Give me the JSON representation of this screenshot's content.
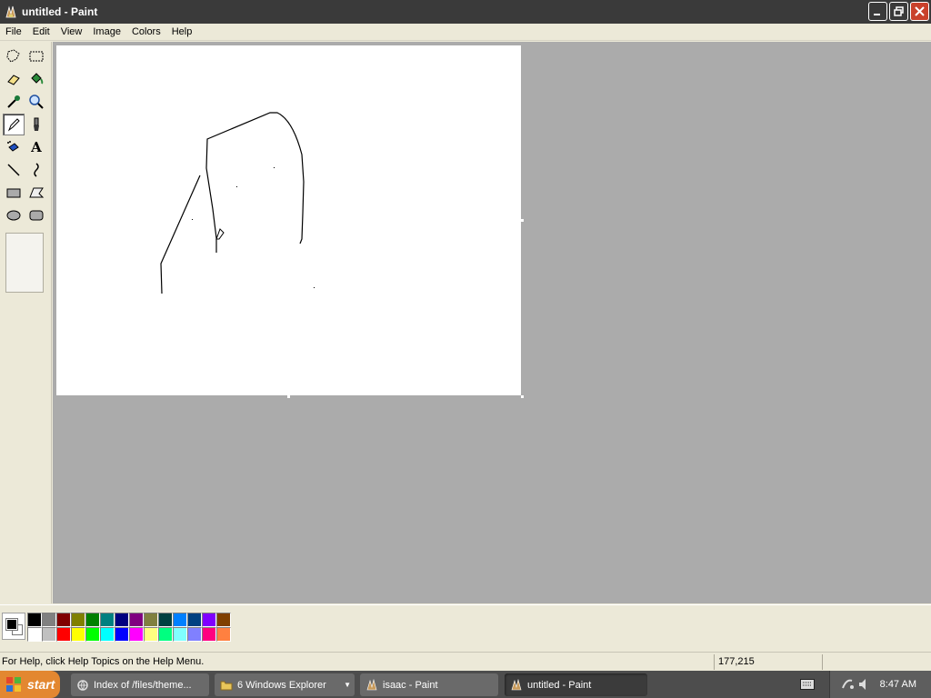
{
  "window": {
    "title": "untitled - Paint",
    "buttons": [
      "minimize",
      "restore",
      "close"
    ]
  },
  "menu": {
    "items": [
      "File",
      "Edit",
      "View",
      "Image",
      "Colors",
      "Help"
    ]
  },
  "toolbox": {
    "tools": [
      {
        "name": "free-form-select",
        "icon": "free-select-icon"
      },
      {
        "name": "select",
        "icon": "rect-select-icon"
      },
      {
        "name": "eraser",
        "icon": "eraser-icon"
      },
      {
        "name": "fill-with-color",
        "icon": "paint-bucket-icon"
      },
      {
        "name": "pick-color",
        "icon": "eyedropper-icon"
      },
      {
        "name": "magnifier",
        "icon": "magnifier-icon"
      },
      {
        "name": "pencil",
        "icon": "pencil-icon",
        "active": true
      },
      {
        "name": "brush",
        "icon": "brush-icon"
      },
      {
        "name": "airbrush",
        "icon": "airbrush-icon"
      },
      {
        "name": "text",
        "icon": "text-icon",
        "glyph": "A"
      },
      {
        "name": "line",
        "icon": "line-icon"
      },
      {
        "name": "curve",
        "icon": "curve-icon"
      },
      {
        "name": "rectangle",
        "icon": "rectangle-icon"
      },
      {
        "name": "polygon",
        "icon": "polygon-icon"
      },
      {
        "name": "ellipse",
        "icon": "ellipse-icon"
      },
      {
        "name": "rounded-rectangle",
        "icon": "rounded-rect-icon"
      }
    ]
  },
  "colors": {
    "foreground": "#000000",
    "background": "#ffffff",
    "palette_top": [
      "#000000",
      "#808080",
      "#800000",
      "#808000",
      "#008000",
      "#008080",
      "#000080",
      "#800080",
      "#808040",
      "#004040",
      "#0080ff",
      "#004080",
      "#8000ff",
      "#804000"
    ],
    "palette_bottom": [
      "#ffffff",
      "#c0c0c0",
      "#ff0000",
      "#ffff00",
      "#00ff00",
      "#00ffff",
      "#0000ff",
      "#ff00ff",
      "#ffff80",
      "#00ff80",
      "#80ffff",
      "#8080ff",
      "#ff0080",
      "#ff8040"
    ]
  },
  "status": {
    "help_text": "For Help, click Help Topics on the Help Menu.",
    "coordinates": "177,215"
  },
  "taskbar": {
    "start_label": "start",
    "tasks": [
      {
        "label": "Index of /files/theme...",
        "icon": "browser-icon",
        "active": false
      },
      {
        "label": "6 Windows Explorer",
        "icon": "folder-icon",
        "active": false,
        "has_dropdown": true
      },
      {
        "label": "isaac - Paint",
        "icon": "paint-icon",
        "active": false
      },
      {
        "label": "untitled - Paint",
        "icon": "paint-icon",
        "active": true
      }
    ],
    "clock": "8:47 AM"
  }
}
